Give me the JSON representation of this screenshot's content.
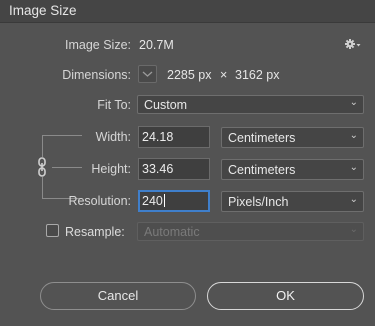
{
  "window": {
    "title": "Image Size"
  },
  "image_size": {
    "label": "Image Size:",
    "value": "20.7M"
  },
  "dimensions": {
    "label": "Dimensions:",
    "width": "2285 px",
    "times": "×",
    "height": "3162 px"
  },
  "fit_to": {
    "label": "Fit To:",
    "value": "Custom"
  },
  "width": {
    "label": "Width:",
    "value": "24.18",
    "unit": "Centimeters"
  },
  "height": {
    "label": "Height:",
    "value": "33.46",
    "unit": "Centimeters"
  },
  "resolution": {
    "label": "Resolution:",
    "value": "240",
    "unit": "Pixels/Inch"
  },
  "resample": {
    "label": "Resample:",
    "value": "Automatic",
    "checked": false
  },
  "buttons": {
    "cancel": "Cancel",
    "ok": "OK"
  }
}
